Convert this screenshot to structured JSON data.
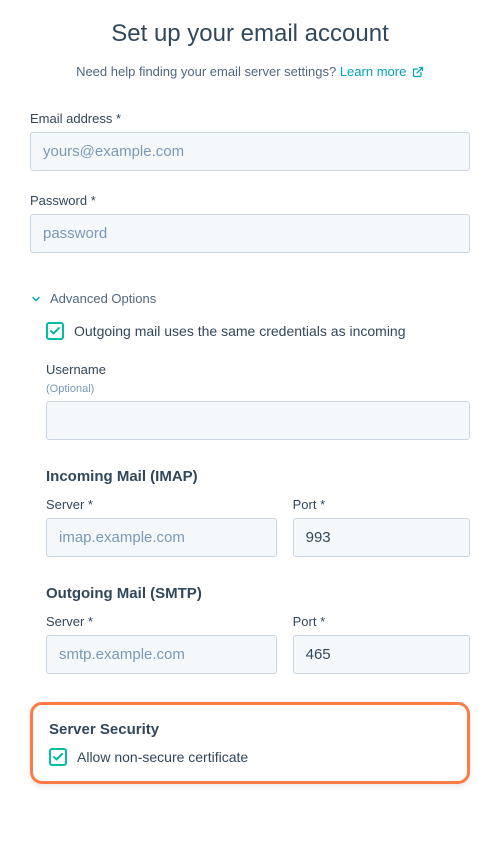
{
  "header": {
    "title": "Set up your email account",
    "subtitle_prefix": "Need help finding your email server settings? ",
    "learn_more_label": "Learn more"
  },
  "fields": {
    "email_label": "Email address *",
    "email_placeholder": "yours@example.com",
    "email_value": "",
    "password_label": "Password *",
    "password_placeholder": "password",
    "password_value": ""
  },
  "advanced": {
    "toggle_label": "Advanced Options",
    "same_creds_label": "Outgoing mail uses the same credentials as incoming",
    "username_label": "Username",
    "username_optional": "(Optional)",
    "username_value": ""
  },
  "incoming": {
    "title": "Incoming Mail (IMAP)",
    "server_label": "Server *",
    "server_placeholder": "imap.example.com",
    "server_value": "",
    "port_label": "Port *",
    "port_value": "993"
  },
  "outgoing": {
    "title": "Outgoing Mail (SMTP)",
    "server_label": "Server *",
    "server_placeholder": "smtp.example.com",
    "server_value": "",
    "port_label": "Port *",
    "port_value": "465"
  },
  "security": {
    "title": "Server Security",
    "allow_label": "Allow non-secure certificate"
  }
}
